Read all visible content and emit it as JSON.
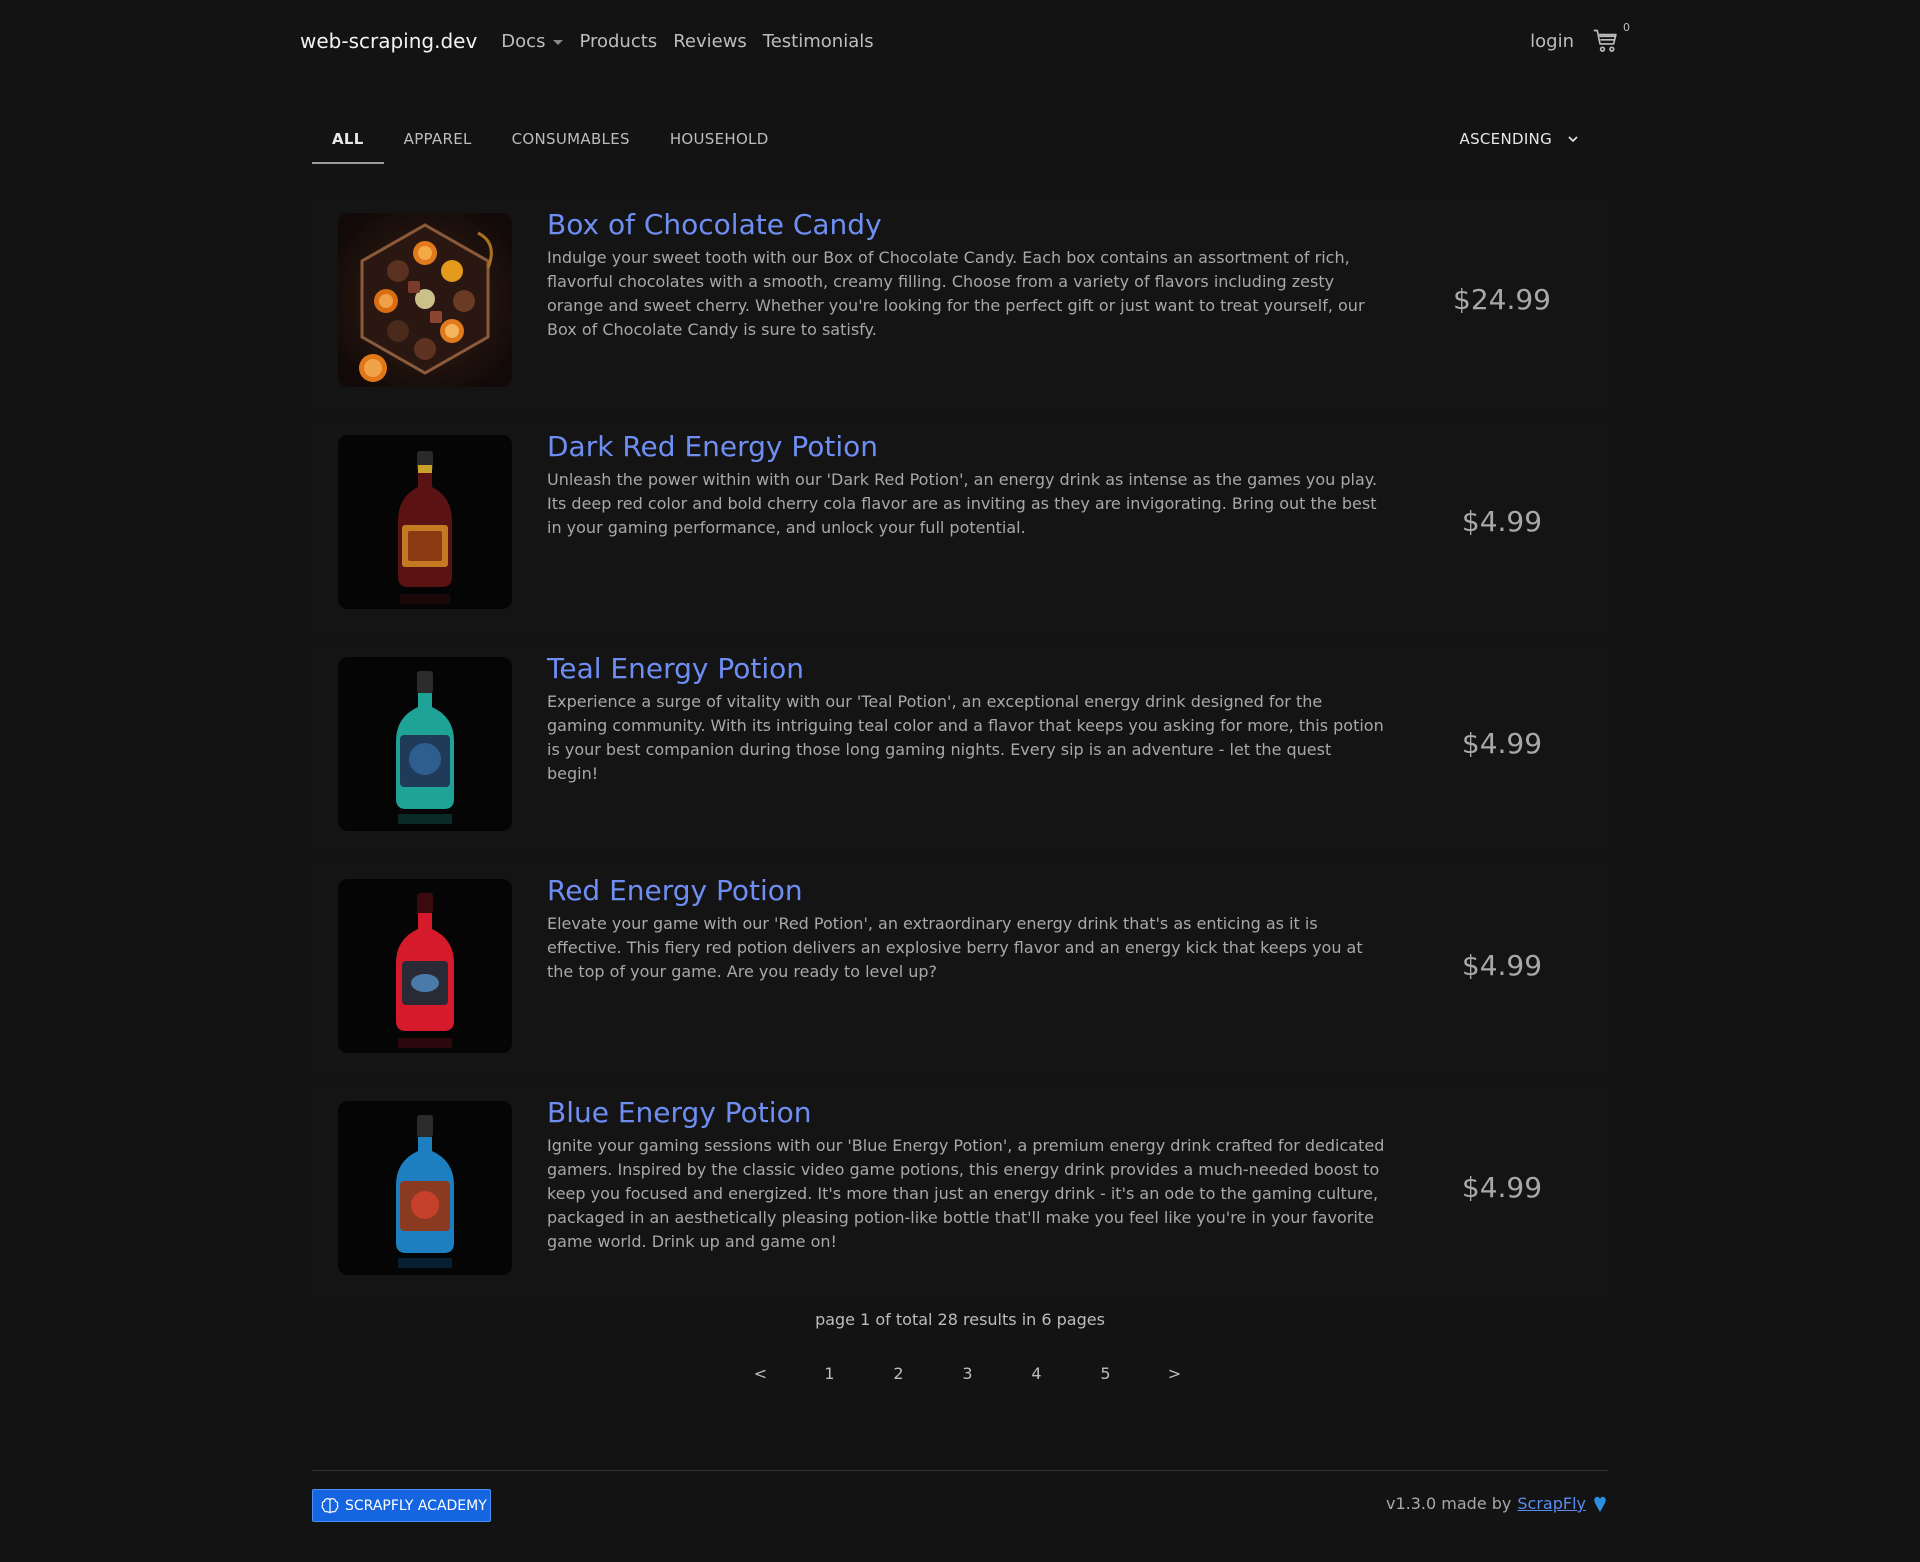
{
  "nav": {
    "brand": "web-scraping.dev",
    "links": [
      "Docs",
      "Products",
      "Reviews",
      "Testimonials"
    ],
    "login": "login",
    "cart_count": "0"
  },
  "tabs": {
    "items": [
      "ALL",
      "APPAREL",
      "CONSUMABLES",
      "HOUSEHOLD"
    ],
    "active": "ALL",
    "sort": "ASCENDING"
  },
  "products": [
    {
      "title": "Box of Chocolate Candy",
      "description": "Indulge your sweet tooth with our Box of Chocolate Candy. Each box contains an assortment of rich, flavorful chocolates with a smooth, creamy filling. Choose from a variety of flavors including zesty orange and sweet cherry. Whether you're looking for the perfect gift or just want to treat yourself, our Box of Chocolate Candy is sure to satisfy.",
      "price": "$24.99",
      "image": "chocolate-box",
      "color": "#d4741c"
    },
    {
      "title": "Dark Red Energy Potion",
      "description": "Unleash the power within with our 'Dark Red Potion', an energy drink as intense as the games you play. Its deep red color and bold cherry cola flavor are as inviting as they are invigorating. Bring out the best in your gaming performance, and unlock your full potential.",
      "price": "$4.99",
      "image": "potion-bottle",
      "color": "#6a1616"
    },
    {
      "title": "Teal Energy Potion",
      "description": "Experience a surge of vitality with our 'Teal Potion', an exceptional energy drink designed for the gaming community. With its intriguing teal color and a flavor that keeps you asking for more, this potion is your best companion during those long gaming nights. Every sip is an adventure - let the quest begin!",
      "price": "$4.99",
      "image": "potion-bottle",
      "color": "#1fa396"
    },
    {
      "title": "Red Energy Potion",
      "description": "Elevate your game with our 'Red Potion', an extraordinary energy drink that's as enticing as it is effective. This fiery red potion delivers an explosive berry flavor and an energy kick that keeps you at the top of your game. Are you ready to level up?",
      "price": "$4.99",
      "image": "potion-bottle",
      "color": "#d51a2c"
    },
    {
      "title": "Blue Energy Potion",
      "description": "Ignite your gaming sessions with our 'Blue Energy Potion', a premium energy drink crafted for dedicated gamers. Inspired by the classic video game potions, this energy drink provides a much-needed boost to keep you focused and energized. It's more than just an energy drink - it's an ode to the gaming culture, packaged in an aesthetically pleasing potion-like bottle that'll make you feel like you're in your favorite game world. Drink up and game on!",
      "price": "$4.99",
      "image": "potion-bottle",
      "color": "#1d7fc0"
    }
  ],
  "paging": {
    "summary": "page 1 of total 28 results in 6 pages",
    "prev": "<",
    "pages": [
      "1",
      "2",
      "3",
      "4",
      "5"
    ],
    "next": ">"
  },
  "footer": {
    "academy": "SCRAPFLY ACADEMY",
    "version_text": "v1.3.0 made by",
    "scrapfly": "ScrapFly"
  },
  "colors": {
    "background": "#131313",
    "link": "#6f8ef2",
    "academy": "#1565e0"
  }
}
